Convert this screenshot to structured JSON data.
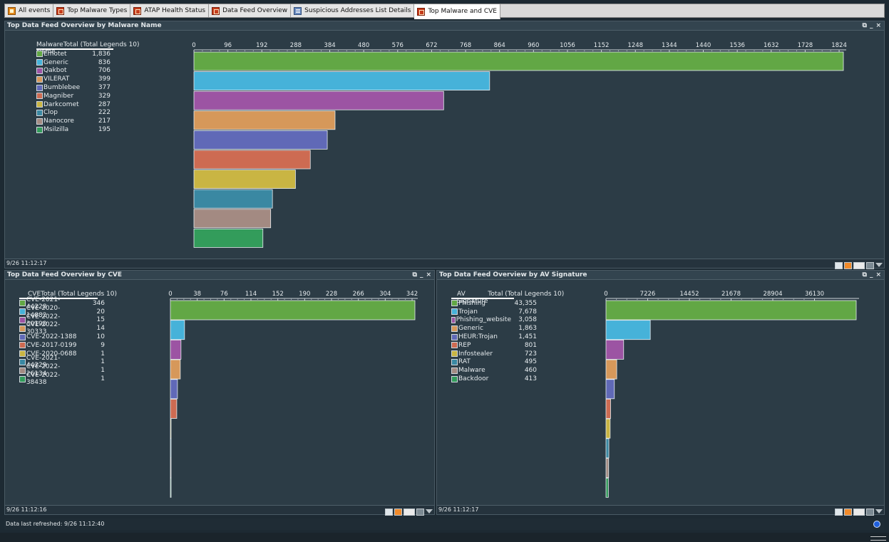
{
  "tabs": [
    {
      "label": "All events",
      "icon": "events-icon",
      "active": false
    },
    {
      "label": "Top Malware Types",
      "icon": "dashboard-icon",
      "active": false
    },
    {
      "label": "ATAP Health Status",
      "icon": "dashboard-icon",
      "active": false
    },
    {
      "label": "Data Feed Overview",
      "icon": "dashboard-icon",
      "active": false
    },
    {
      "label": "Suspicious Addresses List Details",
      "icon": "list-icon",
      "active": false
    },
    {
      "label": "Top Malware and CVE",
      "icon": "dashboard-icon",
      "active": true
    }
  ],
  "panels": {
    "malware": {
      "title": "Top Data Feed Overview by Malware Name",
      "timestamp": "9/26 11:12:17",
      "legend_name_header": "Malware Name",
      "legend_total_header": "Total (Total Legends 10)"
    },
    "cve": {
      "title": "Top Data Feed Overview by CVE",
      "timestamp": "9/26 11:12:16",
      "legend_name_header": "CVE",
      "legend_total_header": "Total (Total Legends 10)"
    },
    "av": {
      "title": "Top Data Feed Overview by AV Signature",
      "timestamp": "9/26 11:12:17",
      "legend_name_header": "AV Signature",
      "legend_total_header": "Total (Total Legends 10)"
    }
  },
  "panel_controls": {
    "restore": "⧉",
    "minimize": "_",
    "close": "×"
  },
  "status": {
    "refreshed": "Data last refreshed: 9/26 11:12:40"
  },
  "colors": [
    "#62a745",
    "#46b2d9",
    "#9c54a3",
    "#d6985a",
    "#6069b7",
    "#cd6b52",
    "#c9b543",
    "#3a88a2",
    "#a38a82",
    "#339c5b"
  ],
  "chart_data": [
    {
      "type": "bar",
      "orientation": "horizontal",
      "title": "Top Data Feed Overview by Malware Name",
      "categories": [
        "Emotet",
        "Generic",
        "Qakbot",
        "VILERAT",
        "Bumblebee",
        "Magniber",
        "Darkcomet",
        "Clop",
        "Nanocore",
        "Msilzilla"
      ],
      "values": [
        1836,
        836,
        706,
        399,
        377,
        329,
        287,
        222,
        217,
        195
      ],
      "value_labels": [
        "1,836",
        "836",
        "706",
        "399",
        "377",
        "329",
        "287",
        "222",
        "217",
        "195"
      ],
      "ticks": [
        0,
        96,
        192,
        288,
        384,
        480,
        576,
        672,
        768,
        864,
        960,
        1056,
        1152,
        1248,
        1344,
        1440,
        1536,
        1632,
        1728,
        1824
      ],
      "xlim": [
        0,
        1836
      ],
      "grid": false,
      "legend": "left"
    },
    {
      "type": "bar",
      "orientation": "horizontal",
      "title": "Top Data Feed Overview by CVE",
      "categories": [
        "CVE-2021-44228",
        "CVE-2020-14882",
        "CVE-2022-30190",
        "CVE-2022-30333",
        "CVE-2022-1388",
        "CVE-2017-0199",
        "CVE-2020-0688",
        "CVE-2021-44229",
        "CVE-2022-26134",
        "CVE-2022-38438"
      ],
      "values": [
        346,
        20,
        15,
        14,
        10,
        9,
        1,
        1,
        1,
        1
      ],
      "value_labels": [
        "346",
        "20",
        "15",
        "14",
        "10",
        "9",
        "1",
        "1",
        "1",
        "1"
      ],
      "ticks": [
        0,
        38,
        76,
        114,
        152,
        190,
        228,
        266,
        304,
        342
      ],
      "xlim": [
        0,
        346
      ],
      "grid": false,
      "legend": "left"
    },
    {
      "type": "bar",
      "orientation": "horizontal",
      "title": "Top Data Feed Overview by AV Signature",
      "categories": [
        "Phishing",
        "Trojan",
        "Phishing_website",
        "Generic",
        "HEUR:Trojan",
        "REP",
        "Infostealer",
        "RAT",
        "Malware",
        "Backdoor"
      ],
      "values": [
        43355,
        7678,
        3058,
        1863,
        1451,
        801,
        723,
        495,
        460,
        413
      ],
      "value_labels": [
        "43,355",
        "7,678",
        "3,058",
        "1,863",
        "1,451",
        "801",
        "723",
        "495",
        "460",
        "413"
      ],
      "ticks": [
        0,
        7226,
        14452,
        21678,
        28904,
        36130
      ],
      "xlim": [
        0,
        43355
      ],
      "grid": false,
      "legend": "left"
    }
  ]
}
